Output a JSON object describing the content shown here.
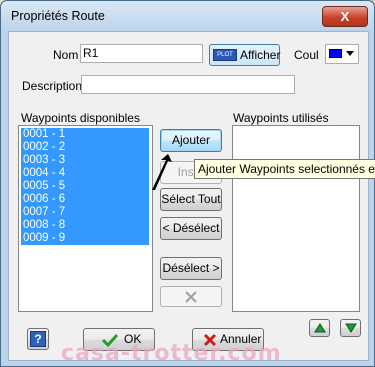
{
  "window": {
    "title": "Propriétés Route",
    "close": "X"
  },
  "form": {
    "nom_label": "Nom",
    "nom_value": "R1",
    "afficher_label": "Afficher",
    "plot_tag": "PLOT",
    "coul_label": "Coul",
    "coul_color": "#0000ff",
    "description_label": "Description",
    "description_value": ""
  },
  "lists": {
    "disponibles_label": "Waypoints disponibles",
    "utilises_label": "Waypoints utilisés",
    "disponibles": [
      "0001 - 1",
      "0002 - 2",
      "0003 - 3",
      "0004 - 4",
      "0005 - 5",
      "0006 - 6",
      "0007 - 7",
      "0008 - 8",
      "0009 - 9"
    ]
  },
  "buttons": {
    "ajouter": "Ajouter",
    "inserer": "Insér",
    "select_tout": "Sélect Tout",
    "deselect": "< Désélect",
    "deselect_right": "Désélect >",
    "help": "?",
    "ok": "OK",
    "annuler": "Annuler"
  },
  "tooltip": "Ajouter Waypoints selectionnés en",
  "watermark": "casa-trotter.com"
}
